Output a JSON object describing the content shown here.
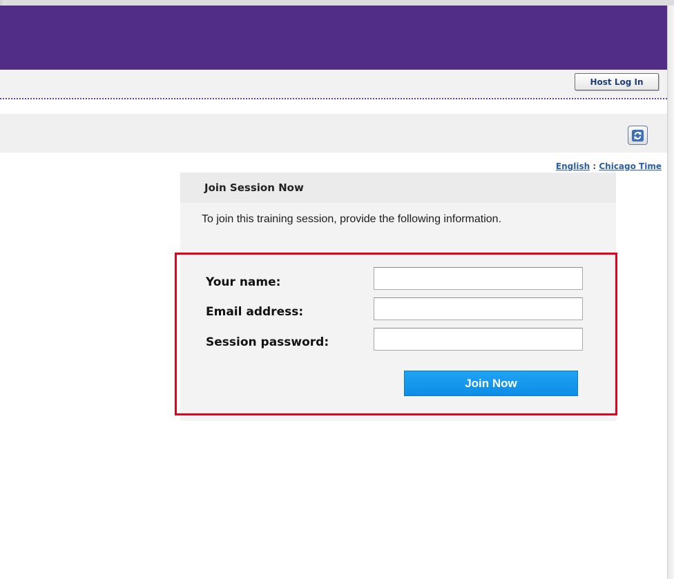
{
  "navbar": {
    "host_login_label": "Host Log In"
  },
  "toolbar": {
    "refresh_icon": "refresh-icon"
  },
  "locale": {
    "language": "English",
    "separator": ":",
    "timezone": "Chicago Time"
  },
  "join_panel": {
    "title": "Join Session Now",
    "description": "To join this training session, provide the following information.",
    "fields": [
      {
        "label": "Your name:",
        "value": "",
        "placeholder": ""
      },
      {
        "label": "Email address:",
        "value": "",
        "placeholder": ""
      },
      {
        "label": "Session password:",
        "value": "",
        "placeholder": ""
      }
    ],
    "submit_label": "Join Now"
  },
  "colors": {
    "header": "#512d87",
    "highlight_box": "#e4001b",
    "join_button": "#1fa3f4",
    "link": "#2a5fa8"
  }
}
